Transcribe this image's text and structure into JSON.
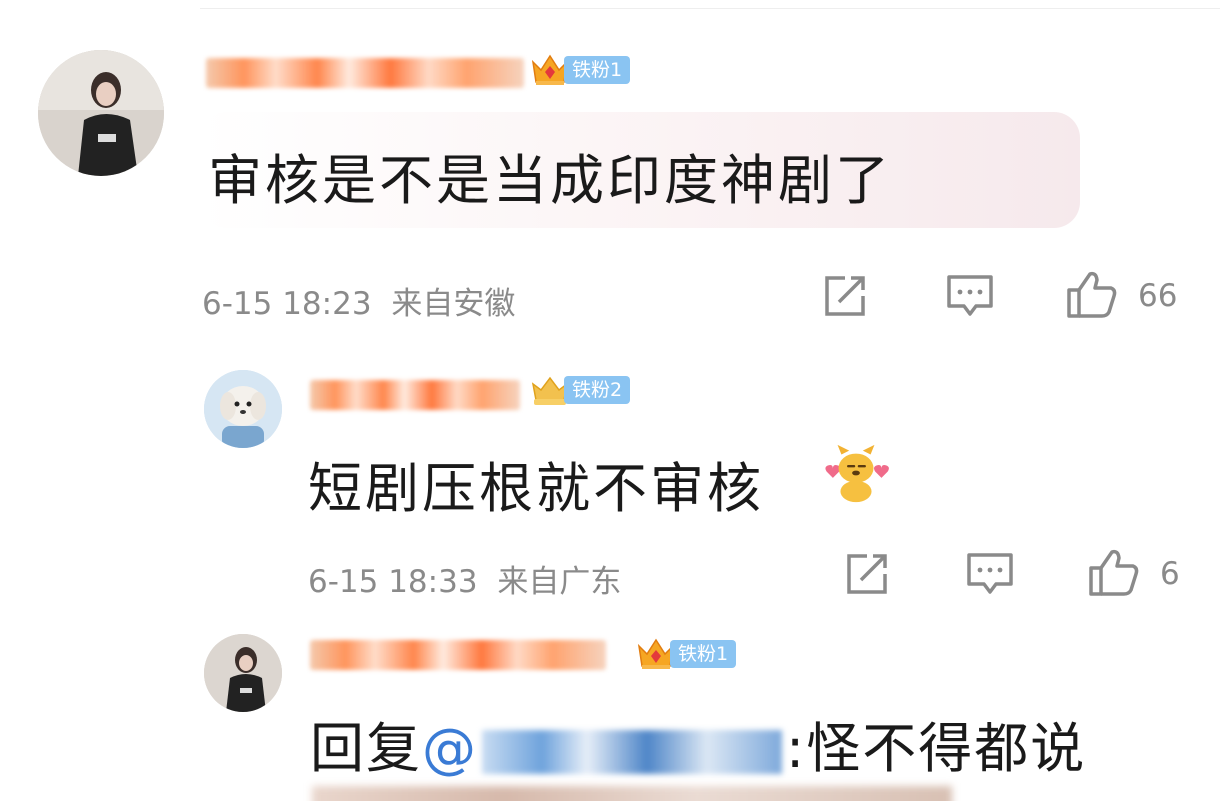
{
  "comments": [
    {
      "badge_label": "铁粉1",
      "text": "审核是不是当成印度神剧了",
      "timestamp": "6-15 18:23",
      "location": "来自安徽",
      "likes": "66"
    },
    {
      "badge_label": "铁粉2",
      "text": "短剧压根就不审核",
      "emoji": "dog-hearts-emoji",
      "timestamp": "6-15 18:33",
      "location": "来自广东",
      "likes": "6"
    },
    {
      "badge_label": "铁粉1",
      "reply_prefix": "回复",
      "reply_at": "@",
      "reply_text": ":怪不得都说"
    }
  ],
  "icons": {
    "share": "share-icon",
    "comment": "comment-icon",
    "like": "thumbs-up-icon",
    "badge": "crown-icon"
  },
  "colors": {
    "badge_bg": "#8ac4f2",
    "meta_text": "#8a8a8a",
    "mention": "#3a7bd5",
    "username_blur": "#ff7a3a"
  }
}
